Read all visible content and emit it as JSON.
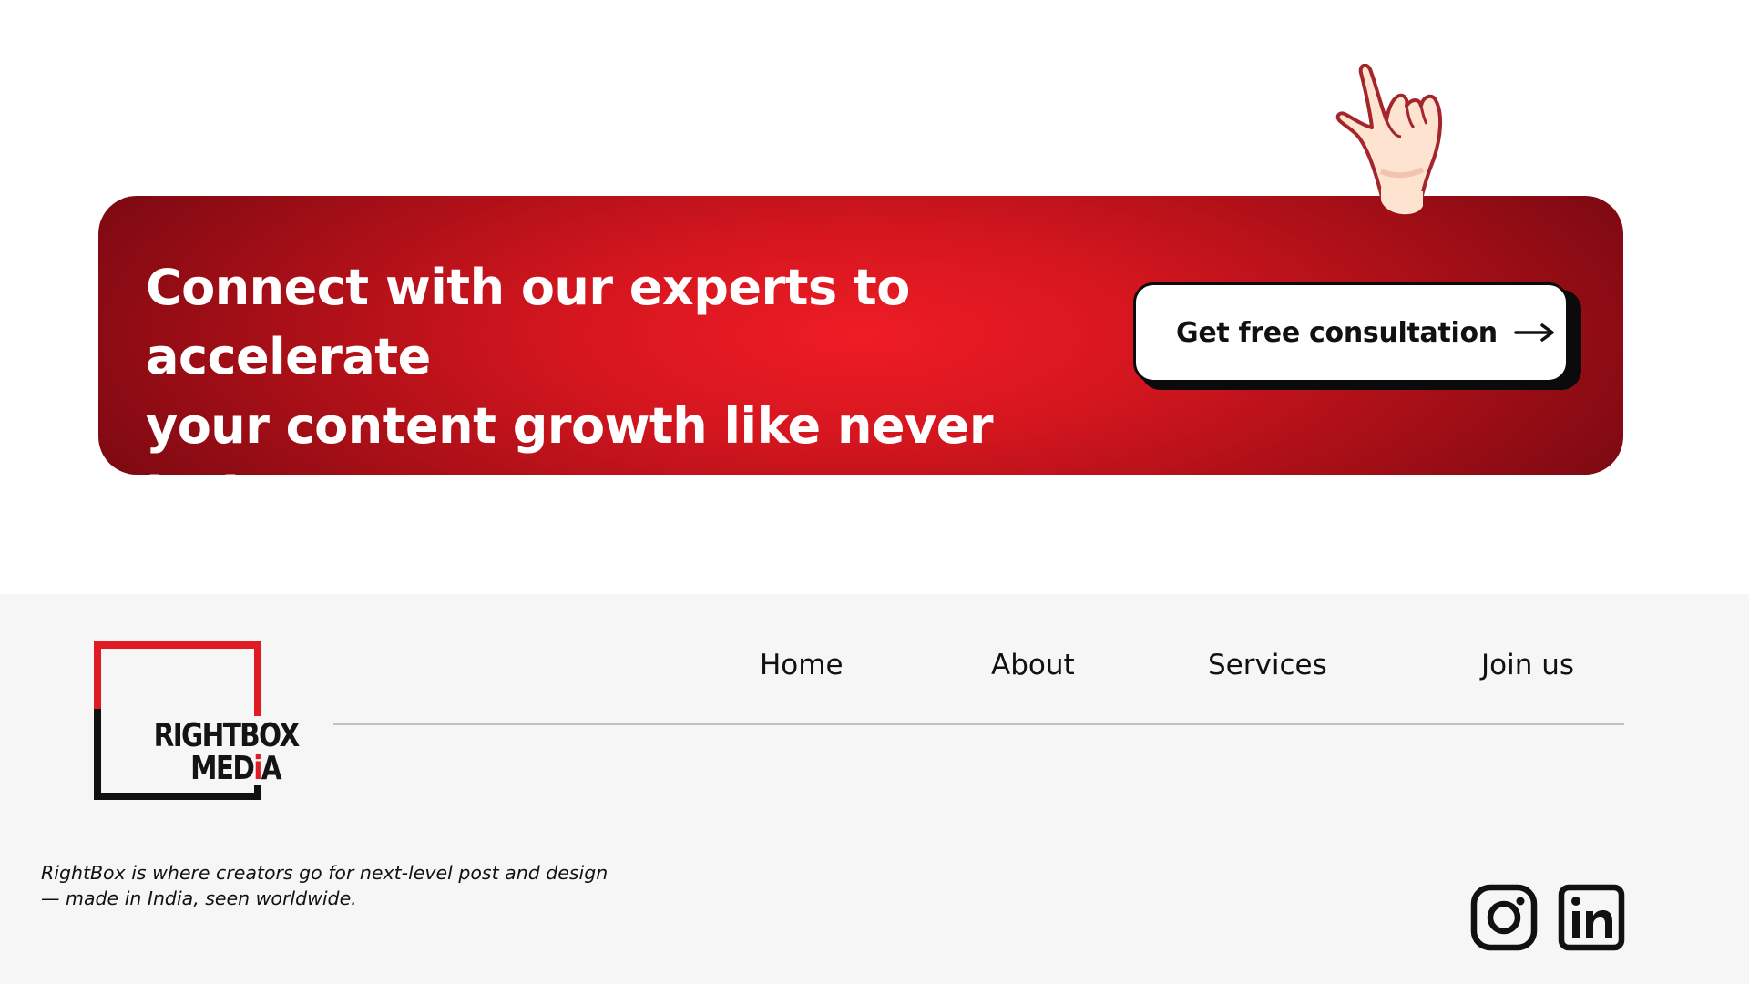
{
  "cta": {
    "headline_line1": "Connect with our experts to accelerate",
    "headline_line2": "your content growth like never before",
    "button_label": "Get free consultation",
    "button_icon": "arrow-right-icon",
    "decoration_icon": "rock-on-hand-icon",
    "colors": {
      "banner_center": "#ee1c25",
      "banner_edge": "#6d0710",
      "button_bg": "#ffffff",
      "button_shadow": "#0b0b0b"
    }
  },
  "footer": {
    "logo": {
      "line1": "RIGHTBOX",
      "line2_prefix": "MED",
      "line2_accent": "i",
      "line2_suffix": "A",
      "accent_color": "#e01b24"
    },
    "nav": [
      {
        "label": "Home"
      },
      {
        "label": "About"
      },
      {
        "label": "Services"
      },
      {
        "label": "Join us"
      }
    ],
    "tagline_line1": "RightBox is where creators go for next-level post and design",
    "tagline_line2": "— made in India, seen worldwide.",
    "social": [
      {
        "icon": "instagram-icon"
      },
      {
        "icon": "linkedin-icon"
      }
    ],
    "colors": {
      "background": "#f6f6f6",
      "divider": "#c2c2c2"
    }
  }
}
